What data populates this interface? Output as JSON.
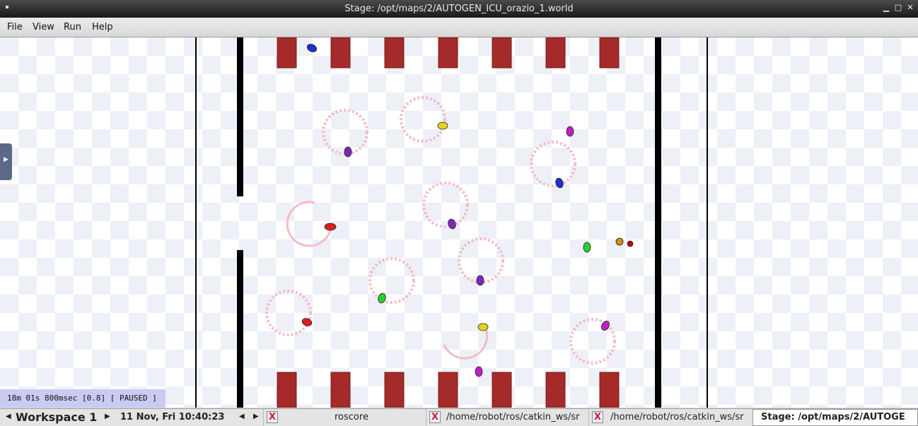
{
  "window": {
    "title": "Stage: /opt/maps/2/AUTOGEN_ICU_orazio_1.world"
  },
  "menu": {
    "items": [
      "File",
      "View",
      "Run",
      "Help"
    ]
  },
  "sim": {
    "status": "18m 01s 800msec [0.8] [ PAUSED ]"
  },
  "taskbar": {
    "workspace": "Workspace 1",
    "datetime": "11 Nov, Fri 10:40:23",
    "tasks": [
      "roscore",
      "/home/robot/ros/catkin_ws/sr",
      "/home/robot/ros/catkin_ws/sr",
      "Stage: /opt/maps/2/AUTOGE"
    ]
  },
  "icons": {
    "app": "terminal-x-icon",
    "prev": "arrow-left-icon",
    "next": "arrow-right-icon"
  },
  "colors": {
    "titlebar": "#2a2a2a",
    "beds": "#a52a2a",
    "walls": "#000000",
    "trail": "#f4b6c2",
    "status_box": "#c9cbf3",
    "robot_colors": [
      "#1e2ed0",
      "#e6d21e",
      "#c020c0",
      "#7a28b8",
      "#d81e1e",
      "#2ccc2c",
      "#b8860b"
    ]
  }
}
